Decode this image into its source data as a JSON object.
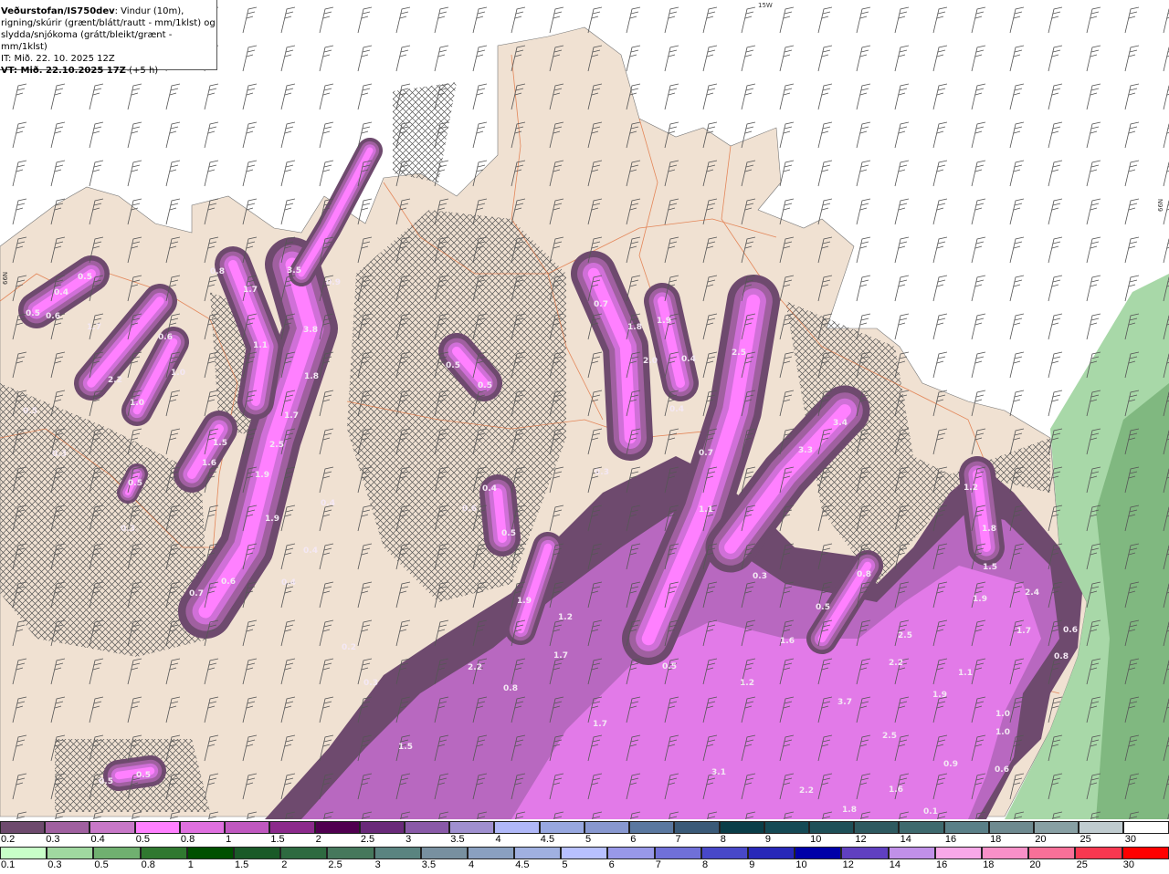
{
  "header": {
    "source": "Veðurstofan/IS750dev",
    "line1_rest": ": Vindur (10m),",
    "line2": "rigning/skúrir (grænt/blátt/rautt - mm/1klst) og",
    "line3": "slydda/snjókoma (grátt/bleikt/grænt - mm/1klst)",
    "it": "IT: Mið. 22. 10. 2025 12Z",
    "vt": "VT: Mið. 22.10.2025 17Z",
    "lead": " (+5 h)"
  },
  "map": {
    "grid_labels": [
      "15W",
      "66N",
      "66N"
    ],
    "colors": {
      "land": "#f0e1d2",
      "sea": "#ffffff",
      "roads": "#e0703c",
      "barbs": "#444444",
      "rain_green": "#a8d8a8"
    },
    "precip_labels": [
      "0.5",
      "0.4",
      "0.5",
      "0.6",
      "1.7",
      "0.6",
      "2.2",
      "1.0",
      "1.0",
      "0.5",
      "0.3",
      "0.5",
      "0.3",
      "0.8",
      "1.7",
      "3.5",
      "0.9",
      "3.8",
      "1.1",
      "1.8",
      "1.7",
      "2.5",
      "1.5",
      "1.6",
      "1.9",
      "1.9",
      "0.4",
      "0.4",
      "0.4",
      "0.6",
      "0.7",
      "0.5",
      "0.5",
      "0.4",
      "0.6",
      "0.5",
      "0.3",
      "0.7",
      "1.8",
      "1.9",
      "2.0",
      "0.4",
      "2.5",
      "0.4",
      "0.7",
      "1.1",
      "3.4",
      "3.3",
      "0.3",
      "0.8",
      "0.5",
      "1.6",
      "1.2",
      "3.7",
      "2.5",
      "2.2",
      "2.5",
      "1.9",
      "1.2",
      "1.7",
      "0.5",
      "2.2",
      "0.8",
      "0.3",
      "0.2",
      "1.5",
      "1.7",
      "3.1",
      "2.2",
      "1.8",
      "0.1",
      "1.6",
      "0.9",
      "0.6",
      "1.0",
      "1.0",
      "1.9",
      "1.1",
      "1.7",
      "2.4",
      "1.9",
      "1.5",
      "1.8",
      "1.2",
      "0.8",
      "0.6",
      "0.5",
      "0.5"
    ]
  },
  "legend_snow": {
    "labels": [
      "0.2",
      "0.3",
      "0.4",
      "0.5",
      "0.8",
      "1",
      "1.5",
      "2",
      "2.5",
      "3",
      "3.5",
      "4",
      "4.5",
      "5",
      "6",
      "7",
      "8",
      "9",
      "10",
      "12",
      "14",
      "16",
      "18",
      "20",
      "25",
      "30"
    ],
    "colors": [
      "#6e4a6e",
      "#a060a0",
      "#c878c8",
      "#ff80ff",
      "#e070e0",
      "#c058c0",
      "#8c2a8c",
      "#500050",
      "#6a2a7a",
      "#8a5aa8",
      "#a090d0",
      "#b0b8f8",
      "#98a8e0",
      "#8898d0",
      "#5a78a0",
      "#3a5a78",
      "#0a3e48",
      "#154a55",
      "#1e5058",
      "#2e5a60",
      "#3e6a6e",
      "#5a8088",
      "#6e8a90",
      "#88a0a4",
      "#c0ccd0",
      "#ffffff"
    ]
  },
  "legend_rain": {
    "labels": [
      "0.1",
      "0.3",
      "0.5",
      "0.8",
      "1",
      "1.5",
      "2",
      "2.5",
      "3",
      "3.5",
      "4",
      "4.5",
      "5",
      "6",
      "7",
      "8",
      "9",
      "10",
      "12",
      "14",
      "16",
      "18",
      "20",
      "25",
      "30"
    ],
    "colors": [
      "#c8ffc8",
      "#a0d8a0",
      "#70b070",
      "#307830",
      "#005000",
      "#1a5a28",
      "#2e6a40",
      "#46785c",
      "#5a8480",
      "#7890a0",
      "#8aa0c0",
      "#a0b0e0",
      "#b8c0ff",
      "#9898e8",
      "#7070d8",
      "#4848c8",
      "#2828b8",
      "#0000a8",
      "#6040c0",
      "#c090e8",
      "#f8a8e8",
      "#f890c8",
      "#f87098",
      "#f83850",
      "#ff0000"
    ]
  }
}
